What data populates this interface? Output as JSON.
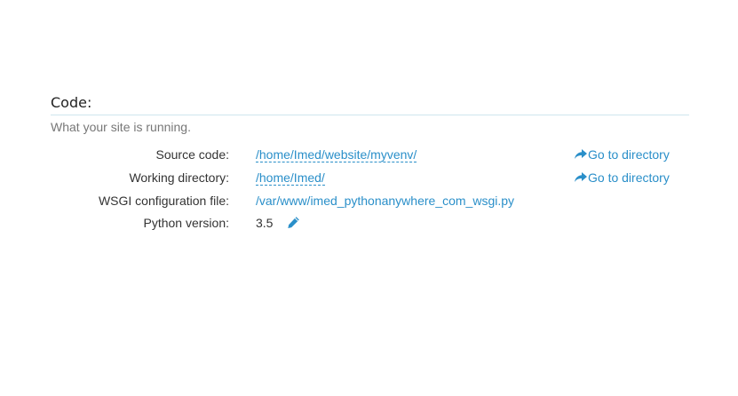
{
  "code_section": {
    "title": "Code:",
    "description": "What your site is running.",
    "rows": [
      {
        "label": "Source code:",
        "value": "/home/Imed/website/myvenv/",
        "action": "Go to directory"
      },
      {
        "label": "Working directory:",
        "value": "/home/Imed/",
        "action": "Go to directory"
      },
      {
        "label": "WSGI configuration file:",
        "value": "/var/www/imed_pythonanywhere_com_wsgi.py"
      },
      {
        "label": "Python version:",
        "value": "3.5",
        "edit_icon": "pencil-icon"
      }
    ]
  },
  "colors": {
    "link": "#2a8fc9",
    "label_text": "#333333",
    "description_text": "#777777",
    "title_rule": "#cfe6ee"
  },
  "icons": {
    "go_to_directory": "share-arrow-icon",
    "edit": "pencil-icon"
  }
}
